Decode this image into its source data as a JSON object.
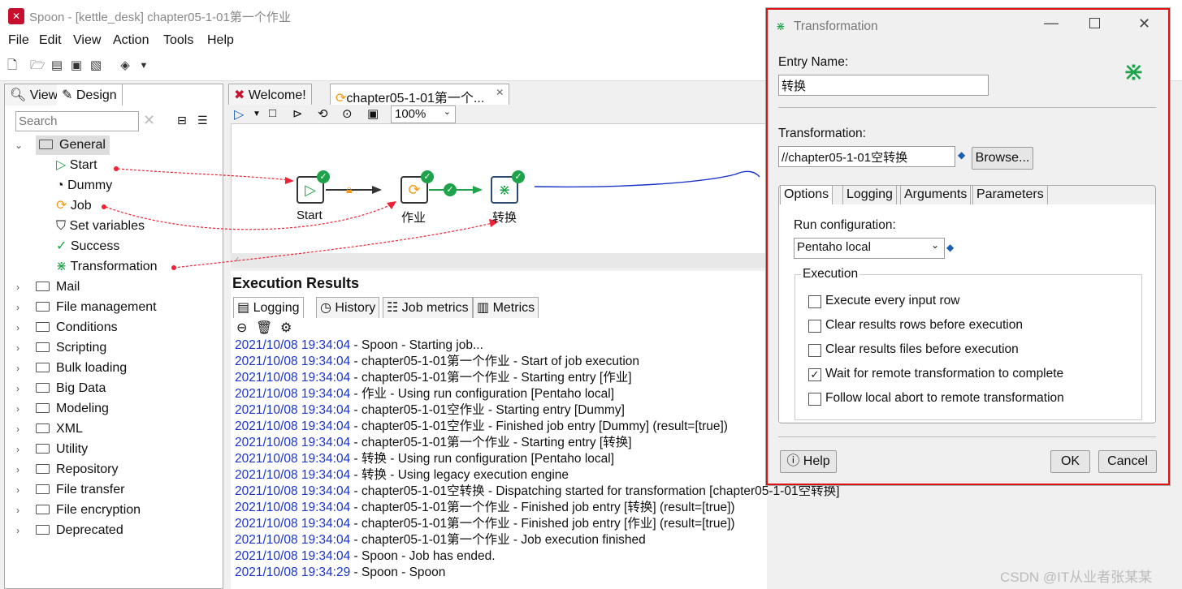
{
  "window": {
    "title": "Spoon - [kettle_desk] chapter05-1-01第一个作业"
  },
  "menu": [
    "File",
    "Edit",
    "View",
    "Action",
    "Tools",
    "Help"
  ],
  "left_panel": {
    "tabs": [
      "View",
      "Design"
    ],
    "search_placeholder": "Search",
    "general": {
      "label": "General",
      "items": [
        "Start",
        "Dummy",
        "Job",
        "Set variables",
        "Success",
        "Transformation"
      ]
    },
    "folders": [
      "Mail",
      "File management",
      "Conditions",
      "Scripting",
      "Bulk loading",
      "Big Data",
      "Modeling",
      "XML",
      "Utility",
      "Repository",
      "File transfer",
      "File encryption",
      "Deprecated"
    ]
  },
  "editor": {
    "tabs": [
      "Welcome!",
      "chapter05-1-01第一个..."
    ],
    "zoom": "100%",
    "nodes": {
      "start": "Start",
      "job": "作业",
      "trans": "转换"
    }
  },
  "results": {
    "title": "Execution Results",
    "tabs": [
      "Logging",
      "History",
      "Job metrics",
      "Metrics"
    ],
    "log": [
      {
        "ts": "2021/10/08 19:34:04",
        "msg": " - Spoon - Starting job..."
      },
      {
        "ts": "2021/10/08 19:34:04",
        "msg": " - chapter05-1-01第一个作业 - Start of job execution"
      },
      {
        "ts": "2021/10/08 19:34:04",
        "msg": " - chapter05-1-01第一个作业 - Starting entry [作业]"
      },
      {
        "ts": "2021/10/08 19:34:04",
        "msg": " - 作业 - Using run configuration [Pentaho local]"
      },
      {
        "ts": "2021/10/08 19:34:04",
        "msg": " - chapter05-1-01空作业 - Starting entry [Dummy]"
      },
      {
        "ts": "2021/10/08 19:34:04",
        "msg": " - chapter05-1-01空作业 - Finished job entry [Dummy] (result=[true])"
      },
      {
        "ts": "2021/10/08 19:34:04",
        "msg": " - chapter05-1-01第一个作业 - Starting entry [转换]"
      },
      {
        "ts": "2021/10/08 19:34:04",
        "msg": " - 转换 - Using run configuration [Pentaho local]"
      },
      {
        "ts": "2021/10/08 19:34:04",
        "msg": " - 转换 - Using legacy execution engine"
      },
      {
        "ts": "2021/10/08 19:34:04",
        "msg": " - chapter05-1-01空转换 - Dispatching started for transformation [chapter05-1-01空转换]"
      },
      {
        "ts": "2021/10/08 19:34:04",
        "msg": " - chapter05-1-01第一个作业 - Finished job entry [转换] (result=[true])"
      },
      {
        "ts": "2021/10/08 19:34:04",
        "msg": " - chapter05-1-01第一个作业 - Finished job entry [作业] (result=[true])"
      },
      {
        "ts": "2021/10/08 19:34:04",
        "msg": " - chapter05-1-01第一个作业 - Job execution finished"
      },
      {
        "ts": "2021/10/08 19:34:04",
        "msg": " - Spoon - Job has ended."
      },
      {
        "ts": "2021/10/08 19:34:29",
        "msg": " - Spoon - Spoon"
      }
    ]
  },
  "dialog": {
    "title": "Transformation",
    "entry_name_label": "Entry Name:",
    "entry_name_value": "转换",
    "transformation_label": "Transformation:",
    "transformation_value": "//chapter05-1-01空转换",
    "browse": "Browse...",
    "tabs": [
      "Options",
      "Logging",
      "Arguments",
      "Parameters"
    ],
    "run_config_label": "Run configuration:",
    "run_config_value": "Pentaho local",
    "execution_label": "Execution",
    "options": [
      {
        "label": "Execute every input row",
        "checked": false
      },
      {
        "label": "Clear results rows before execution",
        "checked": false
      },
      {
        "label": "Clear results files before execution",
        "checked": false
      },
      {
        "label": "Wait for remote transformation to complete",
        "checked": true
      },
      {
        "label": "Follow local abort to remote transformation",
        "checked": false
      }
    ],
    "help": "Help",
    "ok": "OK",
    "cancel": "Cancel"
  },
  "watermark": "CSDN @IT从业者张某某"
}
